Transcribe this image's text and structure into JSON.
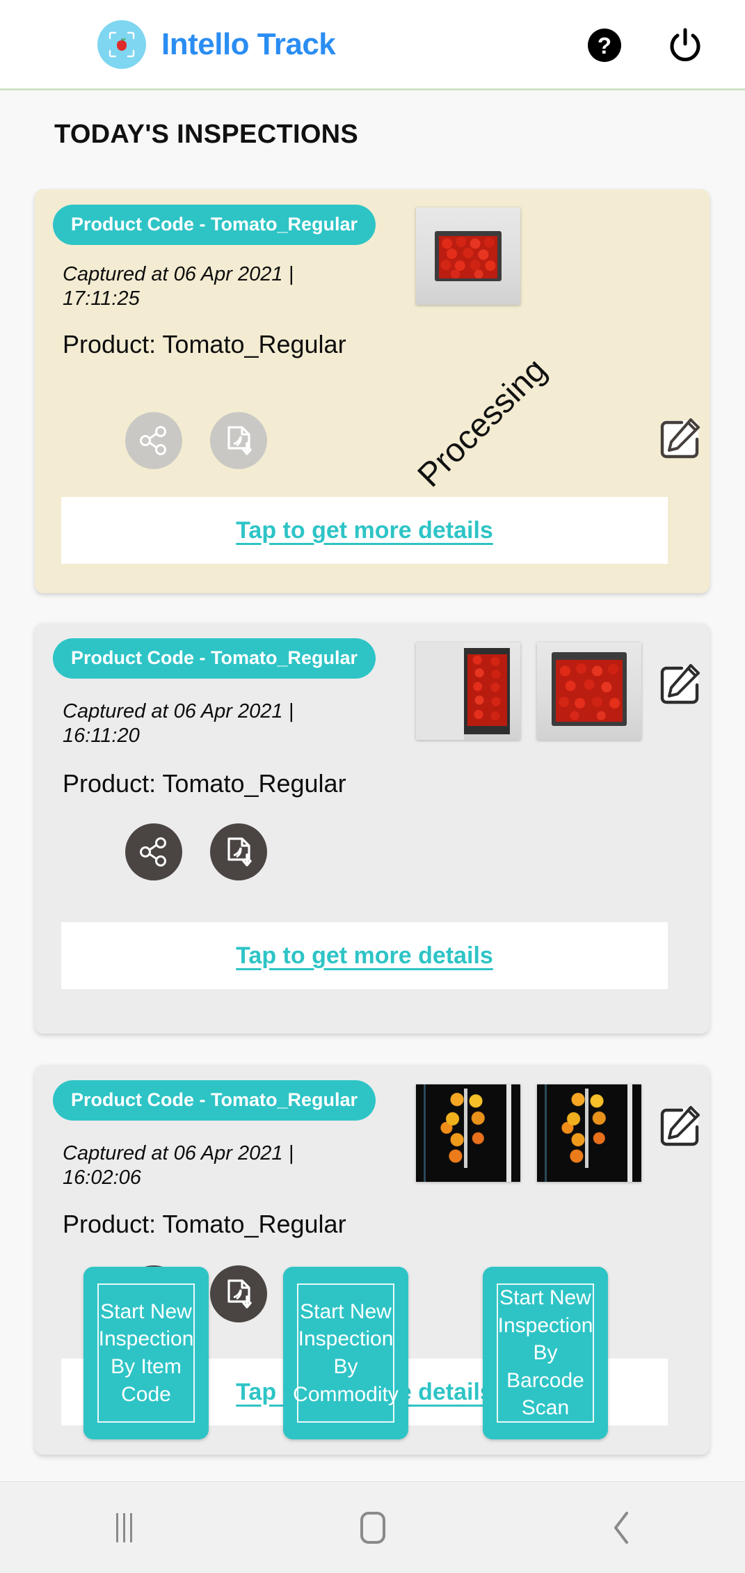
{
  "app": {
    "title": "Intello Track",
    "logo_icon": "apple-scan-icon",
    "help_icon": "help-circle-icon",
    "power_icon": "power-icon",
    "brand_color": "#2a8df2",
    "accent_color": "#2ec4c6"
  },
  "section": {
    "title": "TODAY'S INSPECTIONS"
  },
  "cards": [
    {
      "badge": "Product Code - Tomato_Regular",
      "captured": "Captured at 06 Apr 2021 | 17:11:25",
      "product": "Product: Tomato_Regular",
      "status_watermark": "Processing",
      "details_label": "Tap to get more details",
      "edit_icon": "edit-pencil-icon",
      "share_icon": "share-icon",
      "download_icon": "pdf-download-icon",
      "actions_enabled": false,
      "background": "#f3ecd2",
      "thumbnails": [
        "crate-of-tomatoes-front"
      ]
    },
    {
      "badge": "Product Code - Tomato_Regular",
      "captured": "Captured at 06 Apr 2021 | 16:11:20",
      "product": "Product: Tomato_Regular",
      "status_watermark": "",
      "details_label": "Tap to get more details",
      "edit_icon": "edit-pencil-icon",
      "share_icon": "share-icon",
      "download_icon": "pdf-download-icon",
      "actions_enabled": true,
      "background": "#ececec",
      "thumbnails": [
        "crate-of-tomatoes-side",
        "crate-of-tomatoes-top"
      ]
    },
    {
      "badge": "Product Code - Tomato_Regular",
      "captured": "Captured at 06 Apr 2021 | 16:02:06",
      "product": "Product: Tomato_Regular",
      "status_watermark": "",
      "details_label": "Tap to get more details",
      "edit_icon": "edit-pencil-icon",
      "share_icon": "share-icon",
      "download_icon": "pdf-download-icon",
      "actions_enabled": true,
      "background": "#ececec",
      "thumbnails": [
        "conveyor-tomatoes-1",
        "conveyor-tomatoes-2"
      ]
    }
  ],
  "start_buttons": [
    {
      "label": "Start New Inspection By Item Code",
      "name": "start-inspection-item-code"
    },
    {
      "label": "Start New Inspection By Commodity",
      "name": "start-inspection-commodity"
    },
    {
      "label": "Start New Inspection By Barcode Scan",
      "name": "start-inspection-barcode-scan"
    }
  ],
  "navbar": {
    "recents_icon": "recents-icon",
    "home_icon": "home-icon",
    "back_icon": "back-chevron-icon"
  }
}
